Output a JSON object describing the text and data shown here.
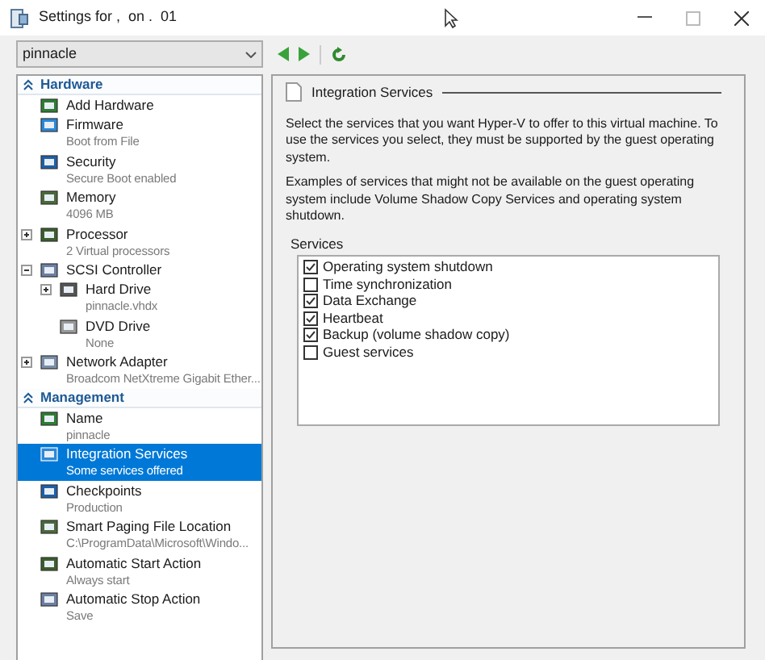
{
  "window": {
    "title": "Settings for ,  on .  01"
  },
  "vm_selector": {
    "value": "pinnacle"
  },
  "sections": [
    {
      "title": "Hardware",
      "expanded": true,
      "items": [
        {
          "name": "Add Hardware"
        },
        {
          "name": "Firmware",
          "detail": "Boot from File"
        },
        {
          "name": "Security",
          "detail": "Secure Boot enabled"
        },
        {
          "name": "Memory",
          "detail": "4096 MB"
        },
        {
          "name": "Processor",
          "detail": "2 Virtual processors",
          "expanded": false
        },
        {
          "name": "SCSI Controller",
          "expanded": true,
          "children": [
            {
              "name": "Hard Drive",
              "detail": "pinnacle.vhdx",
              "expanded": false
            },
            {
              "name": "DVD Drive",
              "detail": "None"
            }
          ]
        },
        {
          "name": "Network Adapter",
          "detail": "Broadcom NetXtreme Gigabit Ether...",
          "expanded": false
        }
      ]
    },
    {
      "title": "Management",
      "expanded": true,
      "items": [
        {
          "name": "Name",
          "detail": "pinnacle",
          "selected": false
        },
        {
          "name": "Integration Services",
          "detail": "Some services offered",
          "selected": true
        },
        {
          "name": "Checkpoints",
          "detail": "Production",
          "selected": false
        },
        {
          "name": "Smart Paging File Location",
          "detail": "C:\\ProgramData\\Microsoft\\Windo...",
          "selected": false
        },
        {
          "name": "Automatic Start Action",
          "detail": "Always start",
          "selected": false
        },
        {
          "name": "Automatic Stop Action",
          "detail": "Save",
          "selected": false
        }
      ]
    }
  ],
  "panel": {
    "title": "Integration Services",
    "paragraphs": [
      "Select the services that you want Hyper-V to offer to this virtual machine. To use the services you select, they must be supported by the guest operating system.",
      "Examples of services that might not be available on the guest operating system include Volume Shadow Copy Services and operating system shutdown."
    ],
    "services_label": "Services",
    "services": [
      {
        "label": "Operating system shutdown",
        "checked": true
      },
      {
        "label": "Time synchronization",
        "checked": false
      },
      {
        "label": "Data Exchange",
        "checked": true
      },
      {
        "label": "Heartbeat",
        "checked": true
      },
      {
        "label": "Backup (volume shadow copy)",
        "checked": true
      },
      {
        "label": "Guest services",
        "checked": false
      }
    ]
  }
}
